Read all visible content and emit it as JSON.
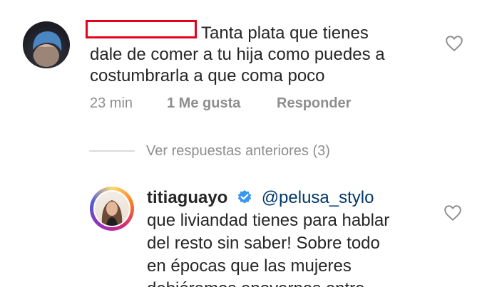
{
  "comment1": {
    "text_line1": "Tanta plata que tienes",
    "text_line2": "dale de comer a tu hija como puedes a",
    "text_line3": "costumbrarla a que coma poco",
    "time": "23 min",
    "likes": "1 Me gusta",
    "reply": "Responder"
  },
  "replies_toggle": {
    "label": "Ver respuestas anteriores (3)"
  },
  "comment2": {
    "username": "titiaguayo",
    "mention": "@pelusa_stylo",
    "text_line1": "que liviandad tienes para hablar",
    "text_line2": "del resto sin saber! Sobre todo",
    "text_line3": "en épocas que las mujeres",
    "text_line4": "debiéramos apoyarnos entre"
  },
  "icons": {
    "like": "heart-icon",
    "verified": "verified-badge-icon"
  },
  "colors": {
    "text": "#262626",
    "secondary": "#8e8e8e",
    "link": "#00376b",
    "verified": "#3897f0",
    "redaction": "#e5001c"
  }
}
